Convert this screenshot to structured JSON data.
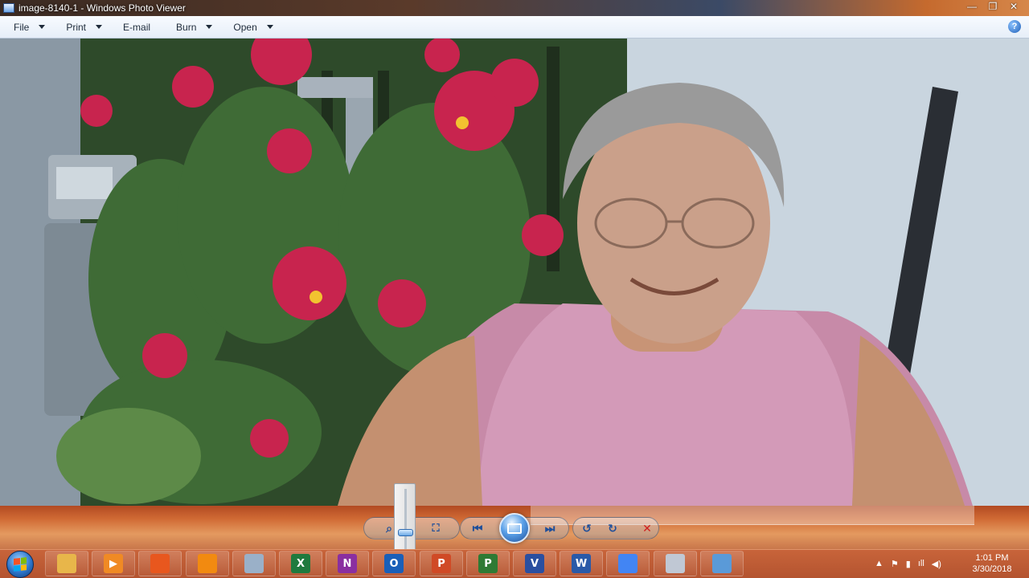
{
  "window": {
    "title": "image-8140-1 - Windows Photo Viewer",
    "buttons": {
      "minimize": "—",
      "maximize": "❐",
      "close": "✕"
    }
  },
  "menu": {
    "items": [
      {
        "label": "File",
        "has_dropdown": true
      },
      {
        "label": "Print",
        "has_dropdown": true
      },
      {
        "label": "E-mail",
        "has_dropdown": false
      },
      {
        "label": "Burn",
        "has_dropdown": true
      },
      {
        "label": "Open",
        "has_dropdown": true
      }
    ],
    "help_label": "?"
  },
  "controls": {
    "zoom_icon": "zoom-icon",
    "actual_size_icon": "actual-size-icon",
    "previous_icon": "previous-icon",
    "slideshow_icon": "slideshow-icon",
    "next_icon": "next-icon",
    "rotate_ccw_icon": "rotate-counterclockwise-icon",
    "rotate_cw_icon": "rotate-clockwise-icon",
    "delete_icon": "delete-icon",
    "zoom_slider_level": 0.3
  },
  "taskbar": {
    "apps": [
      {
        "name": "file-explorer",
        "glyph": "",
        "color": "#e8b64a"
      },
      {
        "name": "media-player",
        "glyph": "▶",
        "color": "#f08a24"
      },
      {
        "name": "firefox",
        "glyph": "",
        "color": "#e8571e"
      },
      {
        "name": "vlc",
        "glyph": "",
        "color": "#f28a10"
      },
      {
        "name": "keyboard",
        "glyph": "",
        "color": "#9ab0c8"
      },
      {
        "name": "excel",
        "glyph": "X",
        "color": "#1f7a3e"
      },
      {
        "name": "onenote",
        "glyph": "N",
        "color": "#8a2fa0"
      },
      {
        "name": "outlook",
        "glyph": "O",
        "color": "#1a5fb8"
      },
      {
        "name": "powerpoint",
        "glyph": "P",
        "color": "#d04a26"
      },
      {
        "name": "project",
        "glyph": "P",
        "color": "#2f7a34"
      },
      {
        "name": "visio",
        "glyph": "V",
        "color": "#2a4fa0"
      },
      {
        "name": "word",
        "glyph": "W",
        "color": "#2a5aa8"
      },
      {
        "name": "chrome",
        "glyph": "",
        "color": "#4285f4"
      },
      {
        "name": "paint",
        "glyph": "",
        "color": "#c0c8d4"
      },
      {
        "name": "photo-viewer",
        "glyph": "",
        "color": "#5a9ad8"
      }
    ],
    "tray_icons": [
      "▲",
      "⚑",
      "▮",
      "ıll",
      "◀)"
    ],
    "clock": {
      "time": "1:01 PM",
      "date": "3/30/2018"
    }
  },
  "colors": {
    "accent": "#1f5fb8",
    "taskbar": "#c8643a",
    "delete": "#d02020"
  }
}
